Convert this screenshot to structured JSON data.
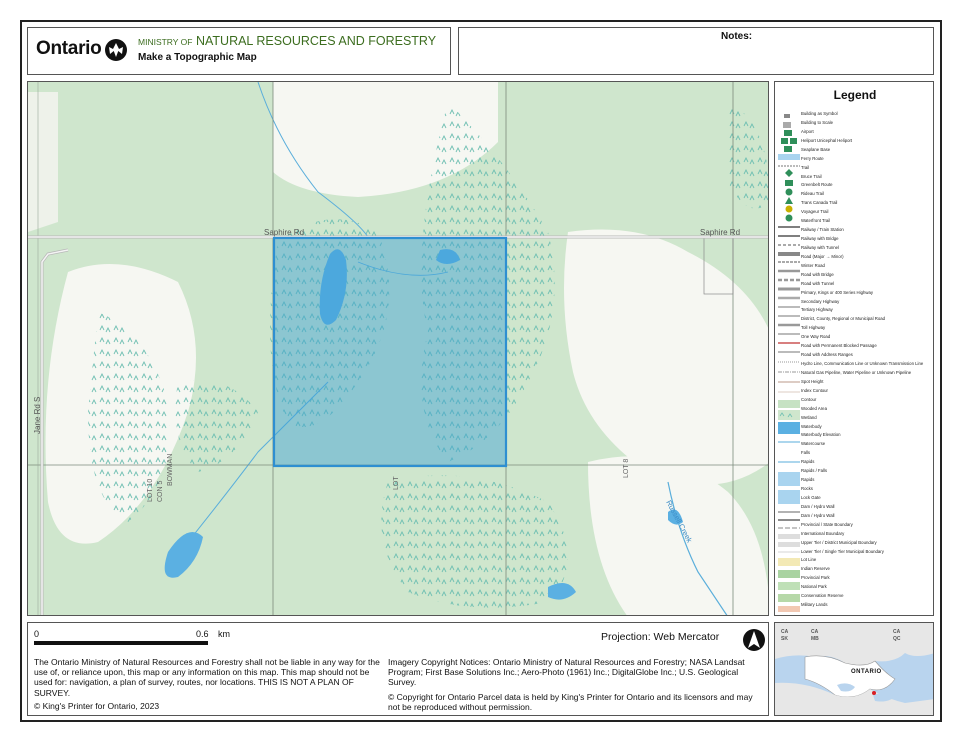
{
  "header": {
    "brand": "Ontario",
    "ministry_prefix": "MINISTRY OF",
    "ministry_name": "NATURAL RESOURCES AND FORESTRY",
    "subtitle": "Make a Topographic Map",
    "notes_label": "Notes:"
  },
  "map": {
    "road_labels": [
      "Saphire Rd",
      "Saphire Rd",
      "Jane Rd S"
    ],
    "lot_labels": [
      "LOT 10",
      "LOT 8",
      "LOT"
    ],
    "owner_label": "BOWMAN",
    "con_label": "CON 5",
    "creek_label": "Russell Creek",
    "highlight_color": "#2e8fd1"
  },
  "legend": {
    "title": "Legend",
    "items": [
      "Building as Symbol",
      "Building to Scale",
      "Airport",
      "Heliport Unicephal Heliport",
      "Seaplane Base",
      "Ferry Route",
      "Trail",
      "Bruce Trail",
      "Greenbelt Route",
      "Rideau Trail",
      "Trans Canada Trail",
      "Voyageur Trail",
      "Waterfront Trail",
      "Railway / Train Station",
      "Railway with Bridge",
      "Railway with Tunnel",
      "Road (Major → Minor)",
      "Winter Road",
      "Road with Bridge",
      "Road with Tunnel",
      "Primary, Kings or 400 Series Highway",
      "Secondary Highway",
      "Tertiary Highway",
      "District, County, Regional or Municipal Road",
      "Toll Highway",
      "One Way Road",
      "Road with Permanent Blocked Passage",
      "Road with Address Ranges",
      "Hydro Line, Communication Line or Unknown Transmission Line",
      "Natural Gas Pipeline, Water Pipeline or Unknown Pipeline",
      "Spot Height",
      "Index Contour",
      "Contour",
      "Wooded Area",
      "Wetland",
      "Waterbody",
      "Waterbody Elevation",
      "Watercourse",
      "Falls",
      "Rapids",
      "Rapids / Falls",
      "Rapids",
      "Rocks",
      "Lock Gate",
      "Dam / Hydro Wall",
      "Dam / Hydro Wall",
      "Provincial / State Boundary",
      "International Boundary",
      "Upper Tier / District Municipal Boundary",
      "Lower Tier / Single Tier Municipal Boundary",
      "Lot Line",
      "Indian Reserve",
      "Provincial Park",
      "National Park",
      "Conservation Reserve",
      "Military Lands"
    ]
  },
  "footer": {
    "scale_start": "0",
    "scale_end": "0.6",
    "scale_unit": "km",
    "projection": "Projection: Web Mercator",
    "disclaimer": "The Ontario Ministry of Natural Resources and Forestry shall not be liable in any way for the use of, or reliance upon, this map or any information on this map.  This map should not be used for: navigation, a plan of survey, routes, nor locations. THIS IS NOT A PLAN OF SURVEY.",
    "copyright": "© King's Printer for Ontario,  2023",
    "imagery": "Imagery Copyright Notices: Ontario Ministry of Natural Resources and Forestry; NASA Landsat Program; First Base Solutions Inc.; Aero-Photo (1961) Inc.; DigitalGlobe Inc.; U.S. Geological Survey.",
    "parcel": "© Copyright for Ontario Parcel data is held by King's Printer for Ontario and its licensors and may not be reproduced without permission."
  },
  "inset": {
    "labels": [
      "CA",
      "SK",
      "CA",
      "MB",
      "CA",
      "QC"
    ],
    "province": "ONTARIO"
  }
}
